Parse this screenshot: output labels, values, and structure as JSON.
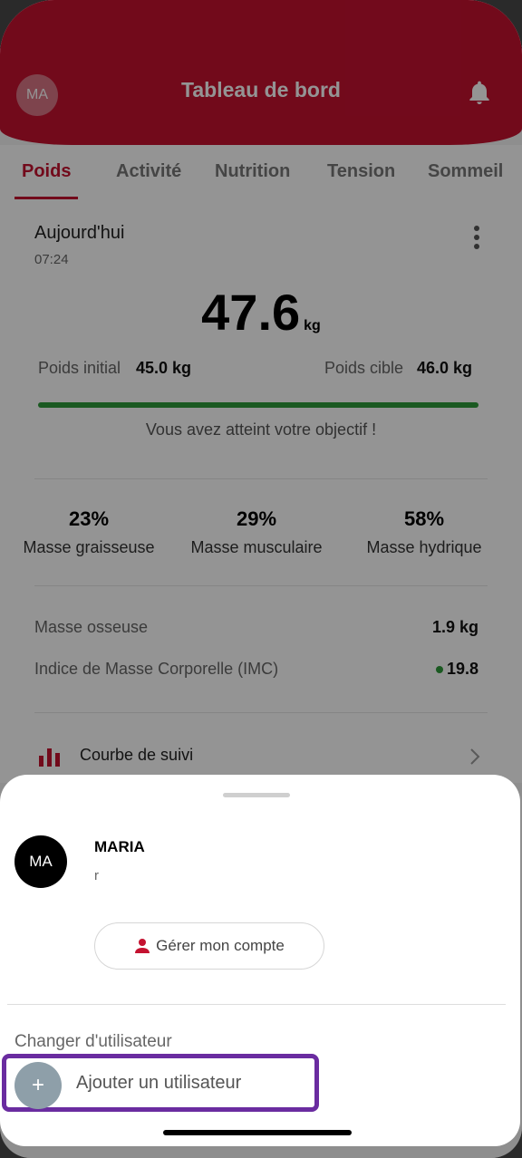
{
  "header": {
    "avatar_initials": "MA",
    "title": "Tableau de bord",
    "bell_icon": "bell-icon",
    "accent_color": "#c41230"
  },
  "tabs": [
    {
      "label": "Poids",
      "active": true
    },
    {
      "label": "Activité",
      "active": false
    },
    {
      "label": "Nutrition",
      "active": false
    },
    {
      "label": "Tension",
      "active": false
    },
    {
      "label": "Sommeil",
      "active": false
    }
  ],
  "weight_card": {
    "day": "Aujourd'hui",
    "time": "07:24",
    "value": "47.6",
    "unit": "kg",
    "initial_label": "Poids initial",
    "initial_value": "45.0 kg",
    "target_label": "Poids cible",
    "target_value": "46.0 kg",
    "progress_fraction": 1.0,
    "goal_message": "Vous avez atteint votre objectif !"
  },
  "metrics": [
    {
      "value": "23%",
      "label": "Masse graisseuse"
    },
    {
      "value": "29%",
      "label": "Masse musculaire"
    },
    {
      "value": "58%",
      "label": "Masse hydrique"
    }
  ],
  "details": [
    {
      "label": "Masse osseuse",
      "value": "1.9 kg"
    },
    {
      "label": "Indice de Masse Corporelle (IMC)",
      "value": "19.8"
    }
  ],
  "tracking": {
    "label": "Courbe de suivi"
  },
  "sheet": {
    "avatar_initials": "MA",
    "user_name": "MARIA",
    "user_sub": "r",
    "manage_label": "Gérer mon compte",
    "switch_label": "Changer d'utilisateur",
    "add_symbol": "+",
    "add_label": "Ajouter un utilisateur"
  }
}
